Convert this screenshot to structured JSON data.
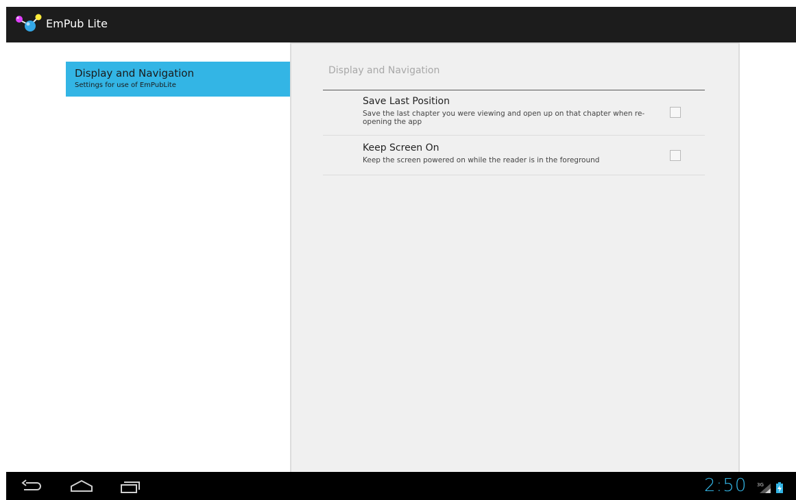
{
  "app": {
    "title": "EmPub Lite"
  },
  "headers": [
    {
      "title": "Display and Navigation",
      "summary": "Settings for use of EmPubLite",
      "selected": true
    }
  ],
  "detail": {
    "category_title": "Display and Navigation",
    "preferences": [
      {
        "title": "Save Last Position",
        "summary": "Save the last chapter you were viewing and open up on that chapter when re-opening the app",
        "checked": false
      },
      {
        "title": "Keep Screen On",
        "summary": "Keep the screen powered on while the reader is in the foreground",
        "checked": false
      }
    ]
  },
  "system_bar": {
    "clock": "2:50",
    "network": "3G",
    "nav_icons": [
      "back-icon",
      "home-icon",
      "recent-apps-icon"
    ]
  },
  "colors": {
    "accent": "#33b5e5",
    "action_bar": "#1c1c1c",
    "detail_background": "#f0f0f0"
  }
}
